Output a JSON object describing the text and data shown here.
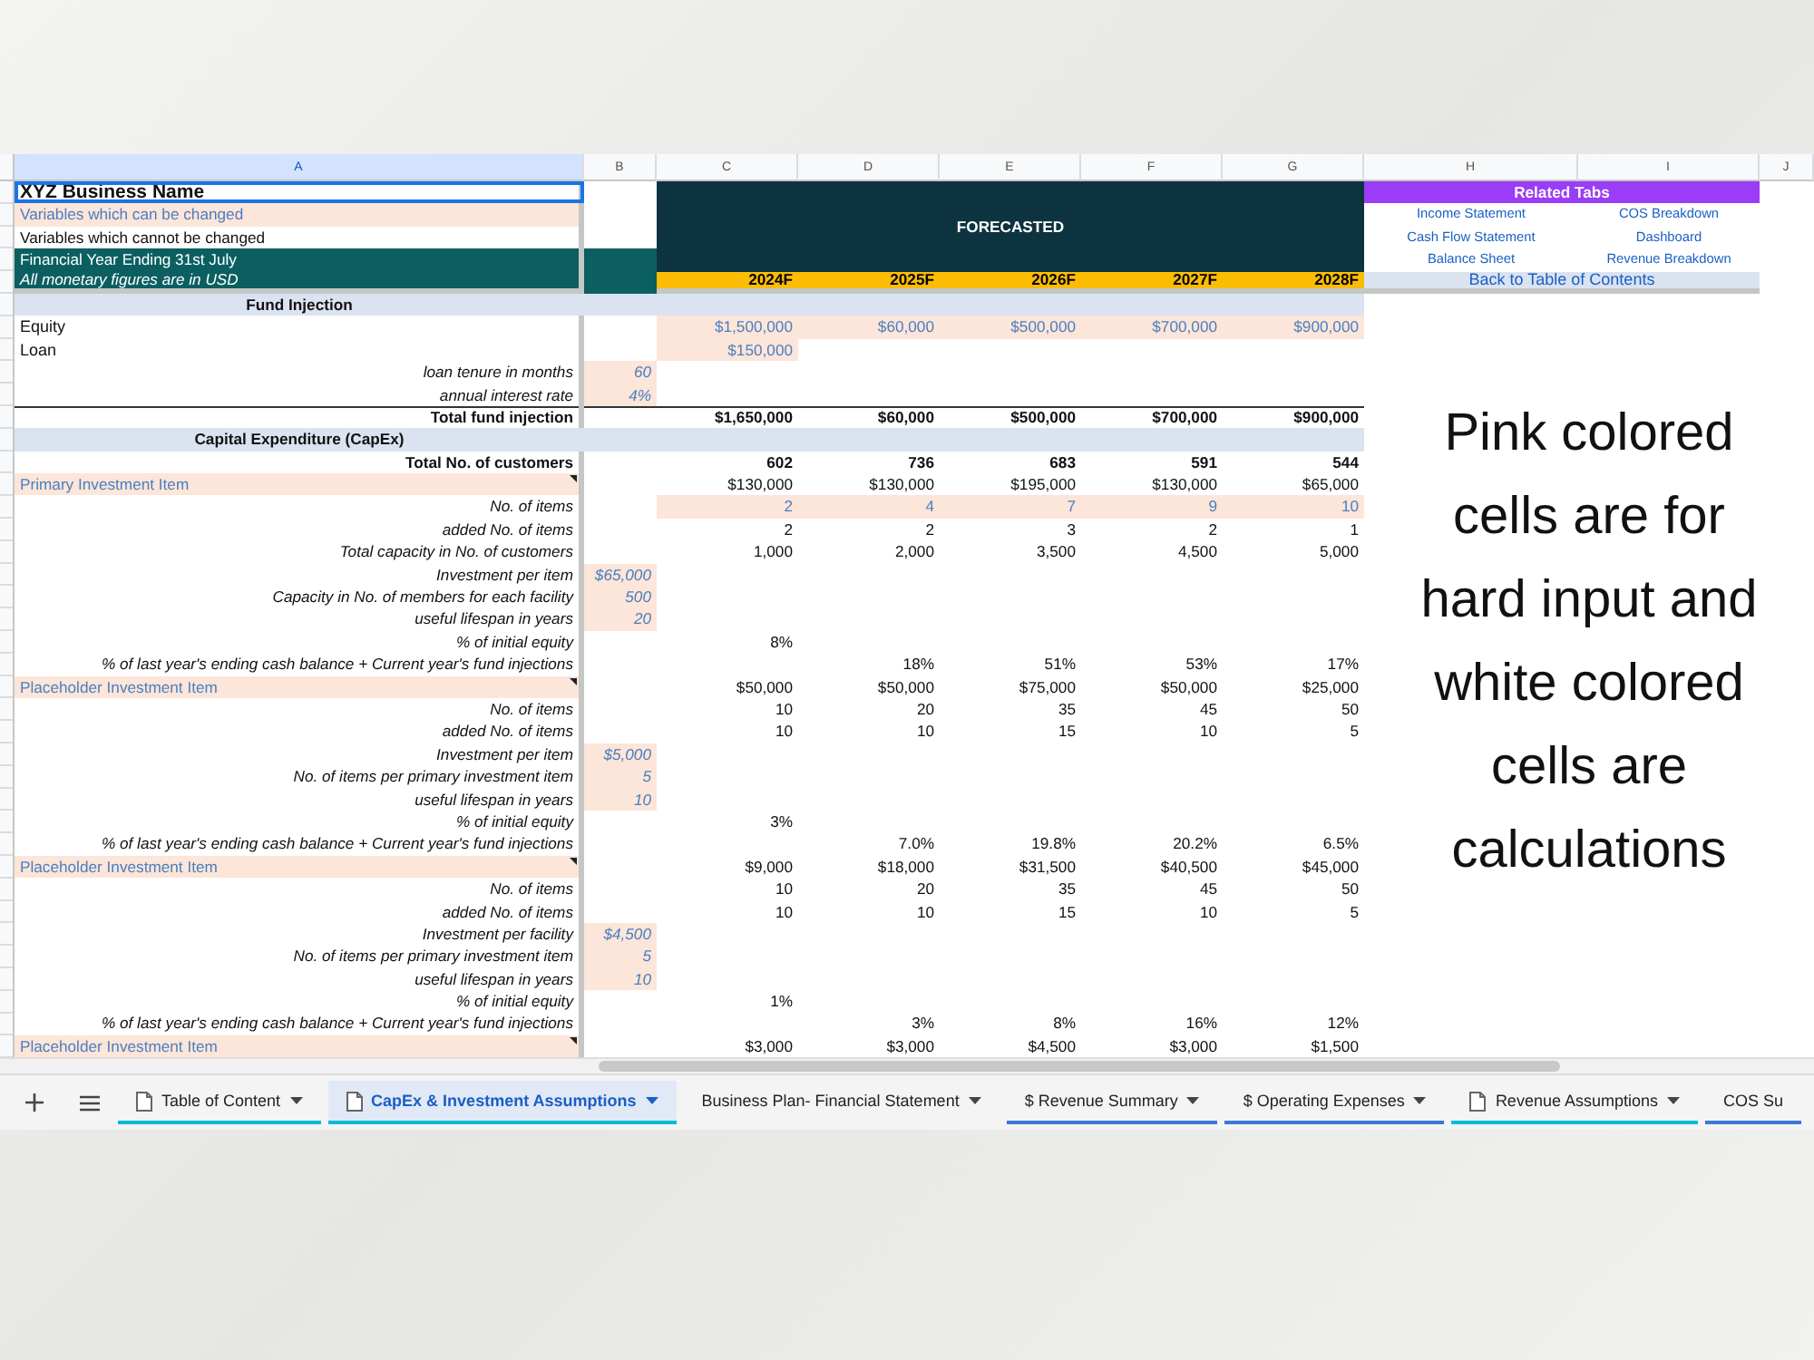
{
  "columns": [
    "A",
    "B",
    "C",
    "D",
    "E",
    "F",
    "G",
    "H",
    "I",
    "J"
  ],
  "forecast": {
    "label": "FORECASTED",
    "years": [
      "2024F",
      "2025F",
      "2026F",
      "2027F",
      "2028F"
    ]
  },
  "related_tabs": {
    "title": "Related Tabs",
    "links": [
      "Income Statement",
      "COS Breakdown",
      "Cash Flow Statement",
      "Dashboard",
      "Balance Sheet",
      "Revenue Breakdown"
    ],
    "back": "Back to Table of Contents"
  },
  "rows": [
    {
      "label": "XYZ Business Name",
      "kind": "title"
    },
    {
      "label": "Variables which can be changed",
      "kind": "legend-input"
    },
    {
      "label": "Variables which cannot be changed",
      "kind": "legend-calc"
    },
    {
      "label": "Financial Year Ending 31st July",
      "kind": "banner"
    },
    {
      "label": "All monetary figures are in USD",
      "kind": "banner-italic"
    },
    {
      "label": "Fund Injection",
      "kind": "section"
    },
    {
      "label": "Equity",
      "kind": "plain",
      "values": [
        "$1,500,000",
        "$60,000",
        "$500,000",
        "$700,000",
        "$900,000"
      ],
      "values_input": true
    },
    {
      "label": "Loan",
      "kind": "plain",
      "values": [
        "$150,000"
      ],
      "values_input": true
    },
    {
      "label": "loan tenure in months",
      "kind": "detail",
      "b": "60",
      "b_input": true
    },
    {
      "label": "annual interest rate",
      "kind": "detail",
      "b": "4%",
      "b_input": true
    },
    {
      "label": "Total fund injection",
      "kind": "total",
      "values": [
        "$1,650,000",
        "$60,000",
        "$500,000",
        "$700,000",
        "$900,000"
      ]
    },
    {
      "label": "Capital Expenditure (CapEx)",
      "kind": "section"
    },
    {
      "label": "Total No. of customers",
      "kind": "bold",
      "values": [
        "602",
        "736",
        "683",
        "591",
        "544"
      ]
    },
    {
      "label": "Primary Investment Item",
      "kind": "item",
      "values": [
        "$130,000",
        "$130,000",
        "$195,000",
        "$130,000",
        "$65,000"
      ]
    },
    {
      "label": "No. of items",
      "kind": "detail",
      "values": [
        "2",
        "4",
        "7",
        "9",
        "10"
      ],
      "values_input": true
    },
    {
      "label": "added No. of items",
      "kind": "detail",
      "values": [
        "2",
        "2",
        "3",
        "2",
        "1"
      ]
    },
    {
      "label": "Total capacity in No. of customers",
      "kind": "detail",
      "values": [
        "1,000",
        "2,000",
        "3,500",
        "4,500",
        "5,000"
      ]
    },
    {
      "label": "Investment per item",
      "kind": "detail",
      "b": "$65,000",
      "b_input": true
    },
    {
      "label": "Capacity in No. of members for each facility",
      "kind": "detail",
      "b": "500",
      "b_input": true
    },
    {
      "label": "useful lifespan in years",
      "kind": "detail",
      "b": "20",
      "b_input": true
    },
    {
      "label": "% of initial equity",
      "kind": "detail",
      "values": [
        "8%"
      ]
    },
    {
      "label": "% of last year's ending cash balance + Current year's fund injections",
      "kind": "growth",
      "values": [
        "18%",
        "51%",
        "53%",
        "17%"
      ]
    },
    {
      "label": "Placeholder Investment Item",
      "kind": "item",
      "values": [
        "$50,000",
        "$50,000",
        "$75,000",
        "$50,000",
        "$25,000"
      ]
    },
    {
      "label": "No. of items",
      "kind": "detail",
      "values": [
        "10",
        "20",
        "35",
        "45",
        "50"
      ]
    },
    {
      "label": "added No. of items",
      "kind": "detail",
      "values": [
        "10",
        "10",
        "15",
        "10",
        "5"
      ]
    },
    {
      "label": "Investment per item",
      "kind": "detail",
      "b": "$5,000",
      "b_input": true
    },
    {
      "label": "No. of items per primary investment item",
      "kind": "detail",
      "b": "5",
      "b_input": true
    },
    {
      "label": "useful lifespan in years",
      "kind": "detail",
      "b": "10",
      "b_input": true
    },
    {
      "label": "% of initial equity",
      "kind": "detail",
      "values": [
        "3%"
      ]
    },
    {
      "label": "% of last year's ending cash balance + Current year's fund injections",
      "kind": "growth",
      "values": [
        "7.0%",
        "19.8%",
        "20.2%",
        "6.5%"
      ]
    },
    {
      "label": "Placeholder Investment Item",
      "kind": "item",
      "values": [
        "$9,000",
        "$18,000",
        "$31,500",
        "$40,500",
        "$45,000"
      ]
    },
    {
      "label": "No. of items",
      "kind": "detail",
      "values": [
        "10",
        "20",
        "35",
        "45",
        "50"
      ]
    },
    {
      "label": "added No. of items",
      "kind": "detail",
      "values": [
        "10",
        "10",
        "15",
        "10",
        "5"
      ]
    },
    {
      "label": "Investment per facility",
      "kind": "detail",
      "b": "$4,500",
      "b_input": true
    },
    {
      "label": "No. of items per primary investment item",
      "kind": "detail",
      "b": "5",
      "b_input": true
    },
    {
      "label": "useful lifespan in years",
      "kind": "detail",
      "b": "10",
      "b_input": true
    },
    {
      "label": "% of initial equity",
      "kind": "detail",
      "values": [
        "1%"
      ]
    },
    {
      "label": "% of last year's ending cash balance + Current year's fund injections",
      "kind": "growth",
      "values": [
        "3%",
        "8%",
        "16%",
        "12%"
      ]
    },
    {
      "label": "Placeholder Investment Item",
      "kind": "item",
      "values": [
        "$3,000",
        "$3,000",
        "$4,500",
        "$3,000",
        "$1,500"
      ]
    }
  ],
  "note": "Pink colored cells are for hard input and white colored cells are calculations",
  "sheet_tabs": [
    {
      "label": "Table of Content",
      "has_icon": true,
      "dropdown": true,
      "selected": false,
      "color": "#00bcd4"
    },
    {
      "label": "CapEx & Investment Assumptions",
      "has_icon": true,
      "dropdown": true,
      "selected": true,
      "color": "#00bcd4"
    },
    {
      "label": "Business Plan- Financial Statement",
      "has_icon": false,
      "dropdown": true,
      "selected": false
    },
    {
      "label": "$ Revenue Summary",
      "has_icon": false,
      "dropdown": true,
      "selected": false,
      "color": "#3c78d8"
    },
    {
      "label": "$ Operating Expenses",
      "has_icon": false,
      "dropdown": true,
      "selected": false,
      "color": "#3c78d8"
    },
    {
      "label": "Revenue Assumptions",
      "has_icon": true,
      "dropdown": true,
      "selected": false,
      "color": "#00bcd4"
    },
    {
      "label": "COS Su",
      "has_icon": false,
      "dropdown": false,
      "selected": false,
      "color": "#3c78d8"
    }
  ]
}
